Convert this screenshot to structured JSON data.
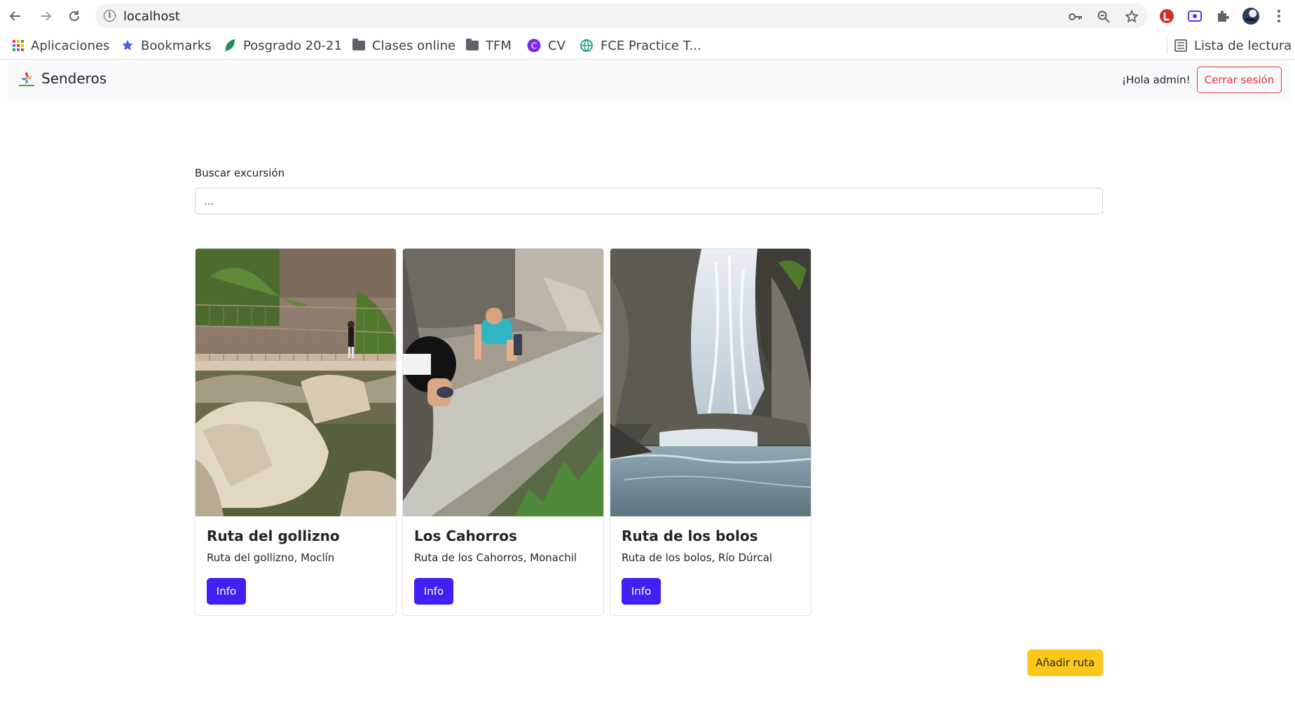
{
  "browser": {
    "url": "localhost",
    "back_icon": "arrow-left-icon",
    "forward_icon": "arrow-right-icon",
    "reload_icon": "reload-icon",
    "bookmarks": [
      {
        "label": "Aplicaciones",
        "icon": "apps-grid-icon"
      },
      {
        "label": "Bookmarks",
        "icon": "star-icon"
      },
      {
        "label": "Posgrado 20-21",
        "icon": "leaf-icon"
      },
      {
        "label": "Clases online",
        "icon": "folder-icon"
      },
      {
        "label": "TFM",
        "icon": "folder-icon"
      },
      {
        "label": "CV",
        "icon": "canva-icon"
      },
      {
        "label": "FCE Practice T...",
        "icon": "globe-icon"
      }
    ],
    "reading_list": "Lista de lectura"
  },
  "navbar": {
    "brand": "Senderos",
    "greeting": "¡Hola admin!",
    "logout": "Cerrar sesión"
  },
  "search": {
    "label": "Buscar excursión",
    "placeholder": "..."
  },
  "cards": [
    {
      "title": "Ruta del gollizno",
      "text": "Ruta del gollizno, Moclín",
      "button": "Info"
    },
    {
      "title": "Los Cahorros",
      "text": "Ruta de los Cahorros, Monachil",
      "button": "Info"
    },
    {
      "title": "Ruta de los bolos",
      "text": "Ruta de los bolos, Río Dúrcal",
      "button": "Info"
    }
  ],
  "add_route": "Añadir ruta",
  "colors": {
    "primary": "#3d21f5",
    "danger": "#dc3545",
    "warning": "#ffc71a",
    "navbar_bg": "#f8f9fa"
  }
}
